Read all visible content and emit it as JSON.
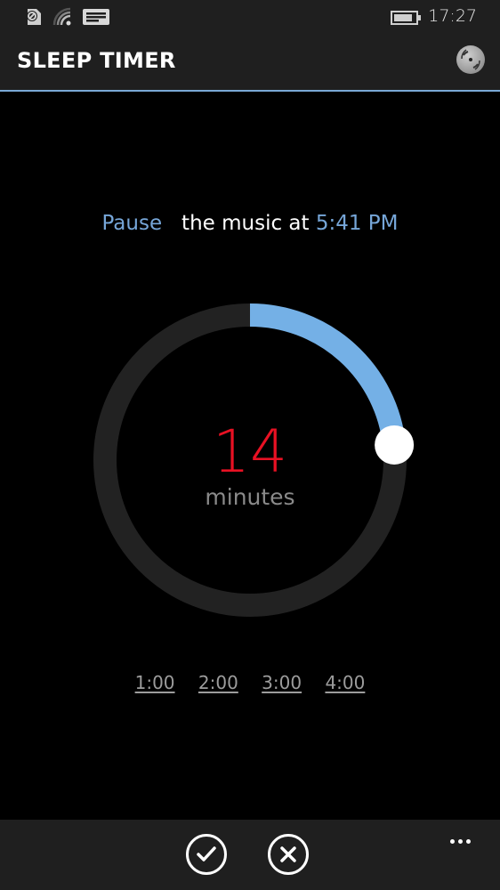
{
  "status_bar": {
    "icons": [
      "sim-card-icon",
      "wifi-icon",
      "message-icon",
      "battery-icon"
    ],
    "time": "17:27"
  },
  "header": {
    "title": "SLEEP TIMER",
    "action_icon": "disc-icon"
  },
  "sentence": {
    "action": "Pause",
    "middle": "the music at",
    "time": "5:41 PM"
  },
  "dial": {
    "value": 14,
    "max": 60,
    "unit_label": "minutes",
    "track_color": "#222222",
    "fill_color": "#74b0e6",
    "value_color": "#e81123"
  },
  "presets": [
    "1:00",
    "2:00",
    "3:00",
    "4:00"
  ],
  "app_bar": {
    "buttons": [
      {
        "name": "confirm",
        "icon": "check-icon"
      },
      {
        "name": "cancel",
        "icon": "close-icon"
      }
    ],
    "more_icon": "ellipsis-icon"
  },
  "colors": {
    "accent": "#76a6d8",
    "chrome": "#1f1f1f",
    "background": "#000000"
  }
}
